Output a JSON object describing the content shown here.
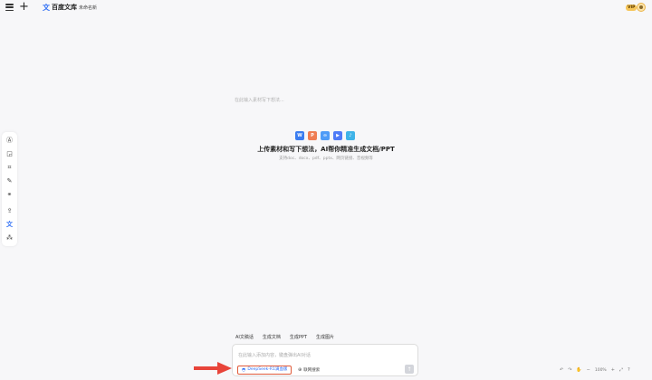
{
  "topbar": {
    "logo_text": "百度文库",
    "doc_title": "未命名新",
    "vip_label": "VIP"
  },
  "editor": {
    "placeholder": "在此输入素材写下想法...",
    "headline": "上传素材和写下想法，AI帮你精准生成文档/PPT",
    "subline": "支持doc、docx、pdf、pptx、网页链接、音视频等"
  },
  "file_icons": [
    {
      "name": "word",
      "glyph": "W",
      "color": "#3b7df0"
    },
    {
      "name": "pdf",
      "glyph": "P",
      "color": "#ef7d52"
    },
    {
      "name": "link",
      "glyph": "∞",
      "color": "#4f9cf7"
    },
    {
      "name": "video",
      "glyph": "▶",
      "color": "#4f7bf7"
    },
    {
      "name": "audio",
      "glyph": "♪",
      "color": "#3fb3e8"
    }
  ],
  "quick_tabs": [
    "AI文稿话",
    "生成文档",
    "生成PPT",
    "生成图片"
  ],
  "input": {
    "placeholder": "在此输入添加内容，键盘弹出AI对话",
    "deepseek_label": "DeepSeek-R1满血版",
    "web_search_label": "联网搜索"
  },
  "zoom": {
    "level": "100%"
  },
  "colors": {
    "accent": "#2f6ff5",
    "highlight_border": "#e05a3a",
    "arrow": "#e8443a"
  }
}
